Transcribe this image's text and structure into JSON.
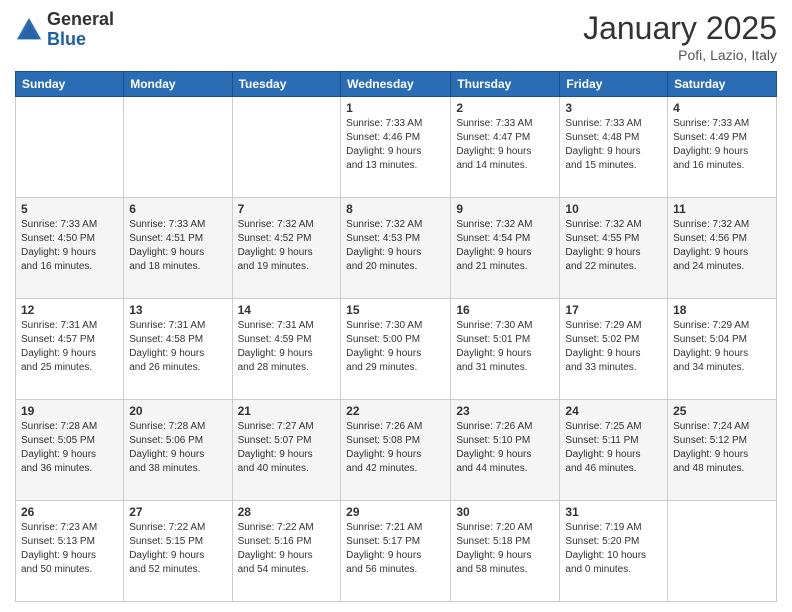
{
  "header": {
    "logo_general": "General",
    "logo_blue": "Blue",
    "month_title": "January 2025",
    "location": "Pofi, Lazio, Italy"
  },
  "days_of_week": [
    "Sunday",
    "Monday",
    "Tuesday",
    "Wednesday",
    "Thursday",
    "Friday",
    "Saturday"
  ],
  "weeks": [
    [
      {
        "day": "",
        "info": ""
      },
      {
        "day": "",
        "info": ""
      },
      {
        "day": "",
        "info": ""
      },
      {
        "day": "1",
        "info": "Sunrise: 7:33 AM\nSunset: 4:46 PM\nDaylight: 9 hours\nand 13 minutes."
      },
      {
        "day": "2",
        "info": "Sunrise: 7:33 AM\nSunset: 4:47 PM\nDaylight: 9 hours\nand 14 minutes."
      },
      {
        "day": "3",
        "info": "Sunrise: 7:33 AM\nSunset: 4:48 PM\nDaylight: 9 hours\nand 15 minutes."
      },
      {
        "day": "4",
        "info": "Sunrise: 7:33 AM\nSunset: 4:49 PM\nDaylight: 9 hours\nand 16 minutes."
      }
    ],
    [
      {
        "day": "5",
        "info": "Sunrise: 7:33 AM\nSunset: 4:50 PM\nDaylight: 9 hours\nand 16 minutes."
      },
      {
        "day": "6",
        "info": "Sunrise: 7:33 AM\nSunset: 4:51 PM\nDaylight: 9 hours\nand 18 minutes."
      },
      {
        "day": "7",
        "info": "Sunrise: 7:32 AM\nSunset: 4:52 PM\nDaylight: 9 hours\nand 19 minutes."
      },
      {
        "day": "8",
        "info": "Sunrise: 7:32 AM\nSunset: 4:53 PM\nDaylight: 9 hours\nand 20 minutes."
      },
      {
        "day": "9",
        "info": "Sunrise: 7:32 AM\nSunset: 4:54 PM\nDaylight: 9 hours\nand 21 minutes."
      },
      {
        "day": "10",
        "info": "Sunrise: 7:32 AM\nSunset: 4:55 PM\nDaylight: 9 hours\nand 22 minutes."
      },
      {
        "day": "11",
        "info": "Sunrise: 7:32 AM\nSunset: 4:56 PM\nDaylight: 9 hours\nand 24 minutes."
      }
    ],
    [
      {
        "day": "12",
        "info": "Sunrise: 7:31 AM\nSunset: 4:57 PM\nDaylight: 9 hours\nand 25 minutes."
      },
      {
        "day": "13",
        "info": "Sunrise: 7:31 AM\nSunset: 4:58 PM\nDaylight: 9 hours\nand 26 minutes."
      },
      {
        "day": "14",
        "info": "Sunrise: 7:31 AM\nSunset: 4:59 PM\nDaylight: 9 hours\nand 28 minutes."
      },
      {
        "day": "15",
        "info": "Sunrise: 7:30 AM\nSunset: 5:00 PM\nDaylight: 9 hours\nand 29 minutes."
      },
      {
        "day": "16",
        "info": "Sunrise: 7:30 AM\nSunset: 5:01 PM\nDaylight: 9 hours\nand 31 minutes."
      },
      {
        "day": "17",
        "info": "Sunrise: 7:29 AM\nSunset: 5:02 PM\nDaylight: 9 hours\nand 33 minutes."
      },
      {
        "day": "18",
        "info": "Sunrise: 7:29 AM\nSunset: 5:04 PM\nDaylight: 9 hours\nand 34 minutes."
      }
    ],
    [
      {
        "day": "19",
        "info": "Sunrise: 7:28 AM\nSunset: 5:05 PM\nDaylight: 9 hours\nand 36 minutes."
      },
      {
        "day": "20",
        "info": "Sunrise: 7:28 AM\nSunset: 5:06 PM\nDaylight: 9 hours\nand 38 minutes."
      },
      {
        "day": "21",
        "info": "Sunrise: 7:27 AM\nSunset: 5:07 PM\nDaylight: 9 hours\nand 40 minutes."
      },
      {
        "day": "22",
        "info": "Sunrise: 7:26 AM\nSunset: 5:08 PM\nDaylight: 9 hours\nand 42 minutes."
      },
      {
        "day": "23",
        "info": "Sunrise: 7:26 AM\nSunset: 5:10 PM\nDaylight: 9 hours\nand 44 minutes."
      },
      {
        "day": "24",
        "info": "Sunrise: 7:25 AM\nSunset: 5:11 PM\nDaylight: 9 hours\nand 46 minutes."
      },
      {
        "day": "25",
        "info": "Sunrise: 7:24 AM\nSunset: 5:12 PM\nDaylight: 9 hours\nand 48 minutes."
      }
    ],
    [
      {
        "day": "26",
        "info": "Sunrise: 7:23 AM\nSunset: 5:13 PM\nDaylight: 9 hours\nand 50 minutes."
      },
      {
        "day": "27",
        "info": "Sunrise: 7:22 AM\nSunset: 5:15 PM\nDaylight: 9 hours\nand 52 minutes."
      },
      {
        "day": "28",
        "info": "Sunrise: 7:22 AM\nSunset: 5:16 PM\nDaylight: 9 hours\nand 54 minutes."
      },
      {
        "day": "29",
        "info": "Sunrise: 7:21 AM\nSunset: 5:17 PM\nDaylight: 9 hours\nand 56 minutes."
      },
      {
        "day": "30",
        "info": "Sunrise: 7:20 AM\nSunset: 5:18 PM\nDaylight: 9 hours\nand 58 minutes."
      },
      {
        "day": "31",
        "info": "Sunrise: 7:19 AM\nSunset: 5:20 PM\nDaylight: 10 hours\nand 0 minutes."
      },
      {
        "day": "",
        "info": ""
      }
    ]
  ]
}
